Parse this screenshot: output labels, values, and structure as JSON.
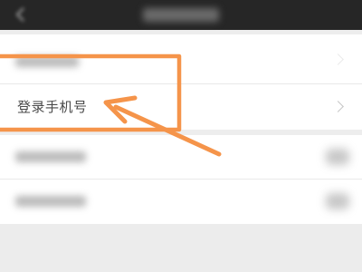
{
  "header": {
    "back_icon": "back-arrow-icon",
    "title": ""
  },
  "settings_list": {
    "items": [
      {
        "label": "",
        "blurred": true,
        "icon": "chevron-right-icon"
      },
      {
        "label": "登录手机号",
        "blurred": false,
        "icon": "chevron-right-icon"
      },
      {
        "label": "",
        "blurred": true,
        "icon": "blurred-icon"
      },
      {
        "label": "",
        "blurred": true,
        "icon": "blurred-icon"
      }
    ]
  },
  "annotation": {
    "color": "#f5944a",
    "shape": "highlight-box-with-arrow"
  },
  "colors": {
    "header_bg": "#262626",
    "page_bg": "#ededed",
    "row_bg": "#ffffff",
    "accent": "#f5944a"
  }
}
